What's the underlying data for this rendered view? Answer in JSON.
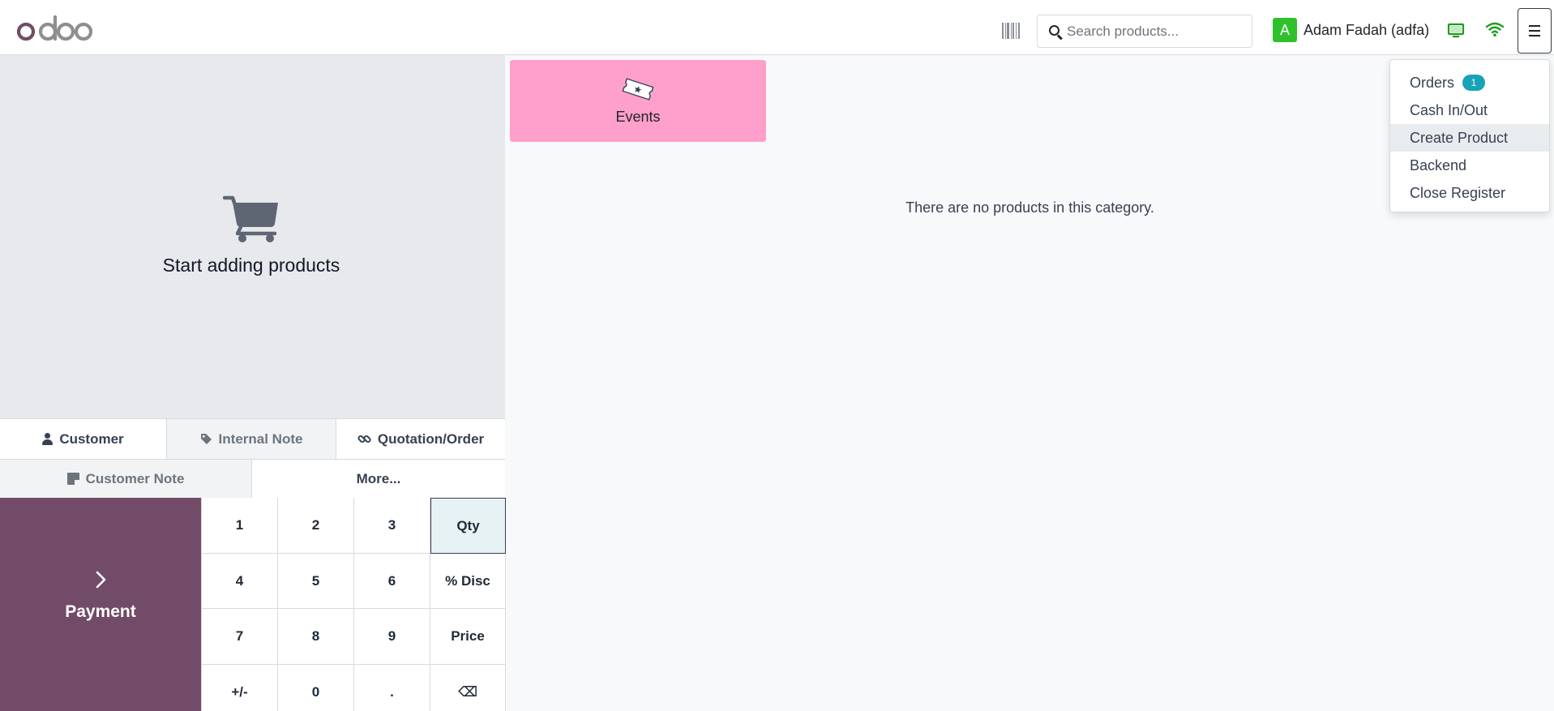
{
  "header": {
    "logo_text": "odoo",
    "search_placeholder": "Search products...",
    "user_initial": "A",
    "user_name": "Adam Fadah (adfa)"
  },
  "order": {
    "empty_message": "Start adding products"
  },
  "controls": {
    "customer": "Customer",
    "internal_note": "Internal Note",
    "quotation_order": "Quotation/Order",
    "customer_note": "Customer Note",
    "more": "More..."
  },
  "payment": {
    "label": "Payment"
  },
  "numpad": {
    "keys": [
      "1",
      "2",
      "3",
      "Qty",
      "4",
      "5",
      "6",
      "% Disc",
      "7",
      "8",
      "9",
      "Price",
      "+/-",
      "0",
      ".",
      "⌫"
    ],
    "active": "Qty"
  },
  "categories": [
    {
      "label": "Events",
      "color": "#ffa0cc"
    }
  ],
  "products": {
    "empty_message": "There are no products in this category."
  },
  "menu": {
    "items": [
      {
        "label": "Orders",
        "badge": "1"
      },
      {
        "label": "Cash In/Out"
      },
      {
        "label": "Create Product"
      },
      {
        "label": "Backend"
      },
      {
        "label": "Close Register"
      }
    ],
    "hovered": "Create Product"
  },
  "colors": {
    "brand": "#714b67",
    "accent_badge": "#17a2b8",
    "avatar": "#2fc12c",
    "status_ok": "#1a9e1a"
  }
}
